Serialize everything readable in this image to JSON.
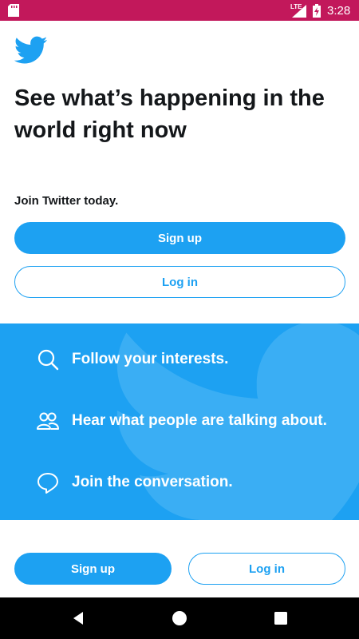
{
  "status_bar": {
    "network": "LTE",
    "time": "3:28",
    "background": "#c2185b"
  },
  "hero": {
    "headline_line1": "See what’s happening in the",
    "headline_line2": "world right now",
    "join_text": "Join Twitter today.",
    "signup_label": "Sign up",
    "login_label": "Log in"
  },
  "features": [
    {
      "icon": "search-icon",
      "text": "Follow your interests."
    },
    {
      "icon": "people-icon",
      "text": "Hear what people are talking about."
    },
    {
      "icon": "chat-bubble-icon",
      "text": "Join the conversation."
    }
  ],
  "footer": {
    "signup_label": "Sign up",
    "login_label": "Log in"
  },
  "colors": {
    "brand_blue": "#1da1f2",
    "text_dark": "#14171a"
  }
}
